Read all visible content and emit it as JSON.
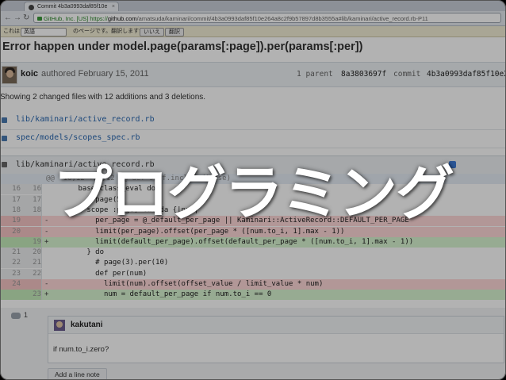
{
  "browser": {
    "tab_title": "Commit 4b3a0993daf85f10e",
    "address": {
      "ev_label": "GitHub, Inc. [US]",
      "scheme": "https://",
      "host": "github.com",
      "path": "/amatsuda/kaminari/commit/4b3a0993daf85f10e264a8c2f9b57897d8b3555a#lib/kaminari/active_record.rb-P11"
    },
    "translate_bar": {
      "prefix": "これは",
      "language": "英語",
      "message": "のページです。翻訳しますか?",
      "no_button": "いいえ",
      "translate_button": "翻訳"
    }
  },
  "commit": {
    "title": "Error happen under model.page(params[:page]).per(params[:per])",
    "author": "koic",
    "authored_text": "authored February 15, 2011",
    "parent_label": "1 parent",
    "parent_sha": "8a3803697f",
    "commit_label": "commit",
    "commit_sha": "4b3a0993daf85f10e2"
  },
  "summary": "Showing 2 changed files with 12 additions and 3 deletions.",
  "files": [
    {
      "name": "lib/kaminari/active_record.rb"
    },
    {
      "name": "spec/models/scopes_spec.rb"
    }
  ],
  "diff": {
    "file": "lib/kaminari/active_record.rb",
    "lines": [
      {
        "kind": "hunk",
        "o": "",
        "n": "",
        "sign": "",
        "code": "@@ -16,12 +16,12 @@ def self.included(base)"
      },
      {
        "kind": "ctx",
        "o": "16",
        "n": "16",
        "sign": "",
        "code": "      base.class_eval do"
      },
      {
        "kind": "ctx",
        "o": "17",
        "n": "17",
        "sign": "",
        "code": "        # page(5)"
      },
      {
        "kind": "ctx",
        "o": "18",
        "n": "18",
        "sign": "",
        "code": "        scope :page, lambda {|num|"
      },
      {
        "kind": "del",
        "o": "19",
        "n": "",
        "sign": "-",
        "code": "          per_page = @_default_per_page || Kaminari::ActiveRecord::DEFAULT_PER_PAGE"
      },
      {
        "kind": "del",
        "o": "20",
        "n": "",
        "sign": "-",
        "code": "          limit(per_page).offset(per_page * ([num.to_i, 1].max - 1))"
      },
      {
        "kind": "add",
        "o": "",
        "n": "19",
        "sign": "+",
        "code": "          limit(default_per_page).offset(default_per_page * ([num.to_i, 1].max - 1))"
      },
      {
        "kind": "ctx",
        "o": "21",
        "n": "20",
        "sign": "",
        "code": "        } do"
      },
      {
        "kind": "ctx",
        "o": "22",
        "n": "21",
        "sign": "",
        "code": "          # page(3).per(10)"
      },
      {
        "kind": "ctx",
        "o": "23",
        "n": "22",
        "sign": "",
        "code": "          def per(num)"
      },
      {
        "kind": "del",
        "o": "24",
        "n": "",
        "sign": "-",
        "code": "            limit(num).offset(offset_value / limit_value * num)"
      },
      {
        "kind": "add",
        "o": "",
        "n": "23",
        "sign": "+",
        "code": "            num = default_per_page if num.to_i == 0"
      }
    ]
  },
  "comment": {
    "count": "1",
    "author": "kakutani",
    "body": "if num.to_i.zero?",
    "add_line_note": "Add a line note"
  },
  "overlay_title": "プログラミング",
  "colors": {
    "link": "#2a68b0",
    "deletion_bg": "#ffd8d8",
    "addition_bg": "#d9f5d2",
    "overlay_text": "#ffffff"
  }
}
